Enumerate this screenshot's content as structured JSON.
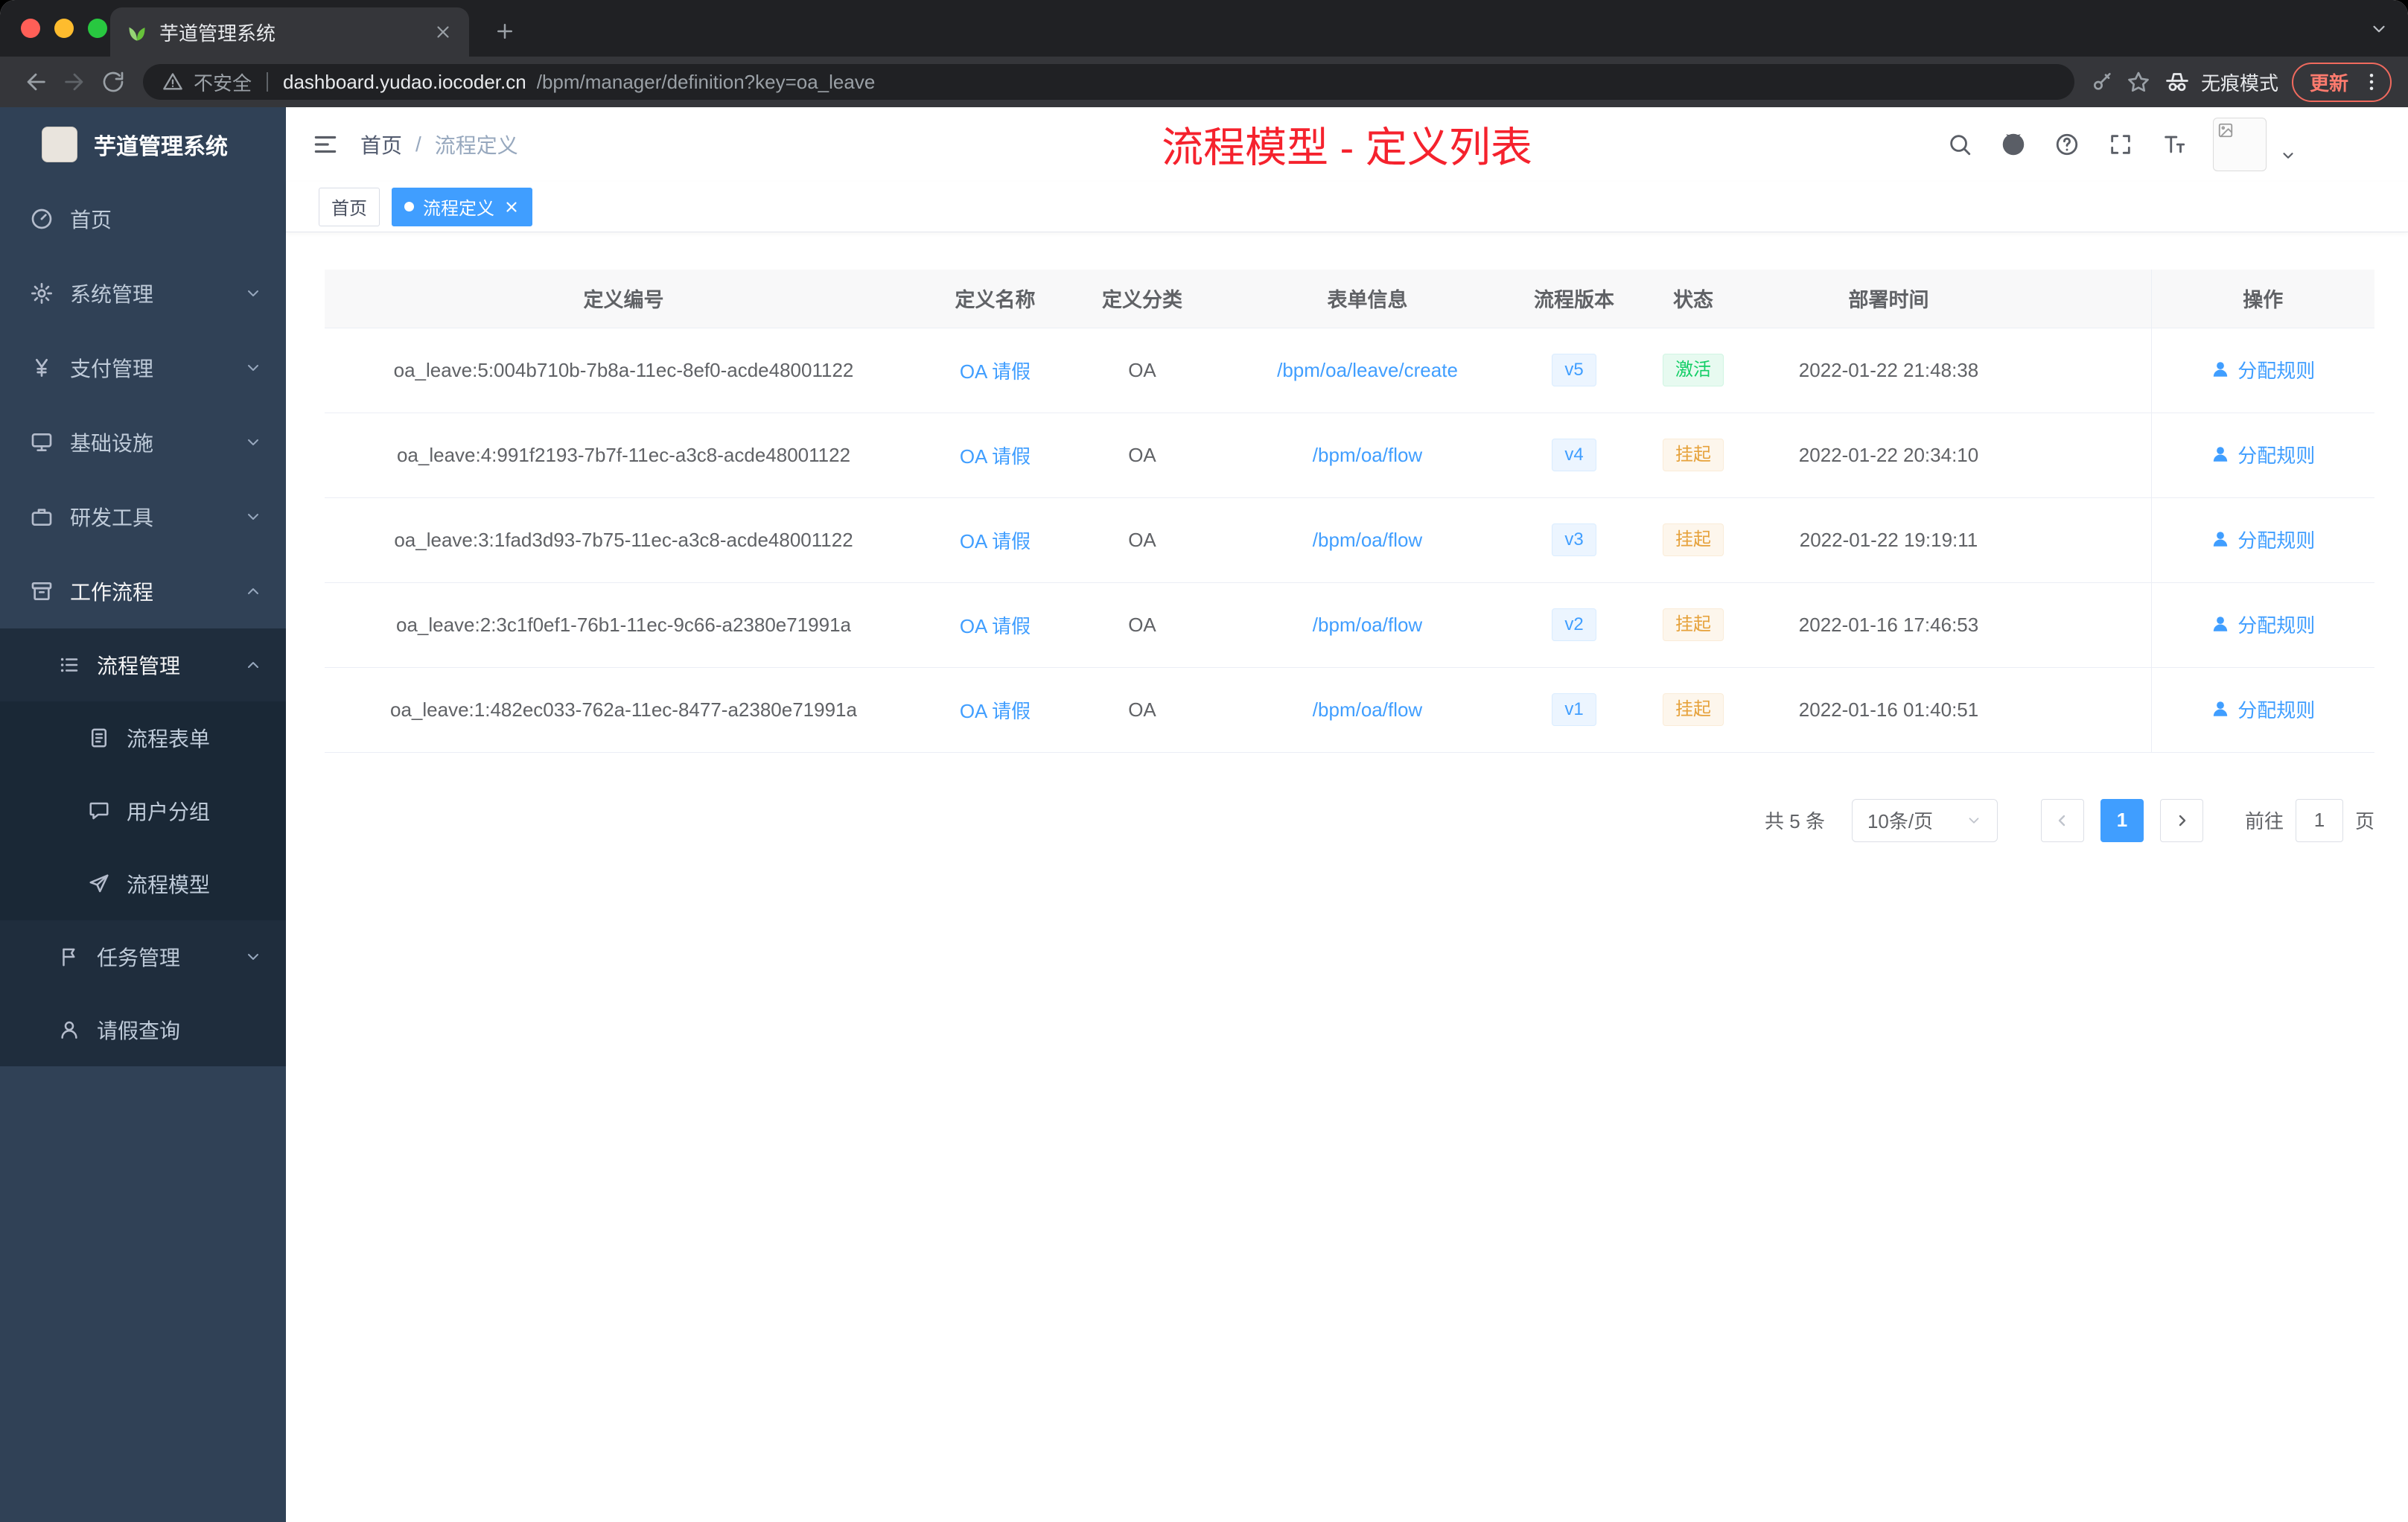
{
  "browser": {
    "tab_title": "芋道管理系统",
    "security_label": "不安全",
    "url_domain": "dashboard.yudao.iocoder.cn",
    "url_path": "/bpm/manager/definition?key=oa_leave",
    "incognito_label": "无痕模式",
    "update_label": "更新"
  },
  "sidebar": {
    "app_title": "芋道管理系统",
    "home": "首页",
    "system_mgmt": "系统管理",
    "payment_mgmt": "支付管理",
    "infrastructure": "基础设施",
    "dev_tools": "研发工具",
    "workflow": "工作流程",
    "process_mgmt": "流程管理",
    "process_form": "流程表单",
    "user_group": "用户分组",
    "process_model": "流程模型",
    "task_mgmt": "任务管理",
    "leave_query": "请假查询"
  },
  "header": {
    "breadcrumb_home": "首页",
    "breadcrumb_sep": "/",
    "breadcrumb_current": "流程定义",
    "annotation": "流程模型 - 定义列表"
  },
  "tags": {
    "home": "首页",
    "active": "流程定义"
  },
  "table": {
    "columns": [
      "定义编号",
      "定义名称",
      "定义分类",
      "表单信息",
      "流程版本",
      "状态",
      "部署时间",
      "操作"
    ],
    "rows": [
      {
        "id": "oa_leave:5:004b710b-7b8a-11ec-8ef0-acde48001122",
        "name": "OA 请假",
        "category": "OA",
        "form": "/bpm/oa/leave/create",
        "version": "v5",
        "status": "激活",
        "time": "2022-01-22 21:48:38",
        "action": "分配规则"
      },
      {
        "id": "oa_leave:4:991f2193-7b7f-11ec-a3c8-acde48001122",
        "name": "OA 请假",
        "category": "OA",
        "form": "/bpm/oa/flow",
        "version": "v4",
        "status": "挂起",
        "time": "2022-01-22 20:34:10",
        "action": "分配规则"
      },
      {
        "id": "oa_leave:3:1fad3d93-7b75-11ec-a3c8-acde48001122",
        "name": "OA 请假",
        "category": "OA",
        "form": "/bpm/oa/flow",
        "version": "v3",
        "status": "挂起",
        "time": "2022-01-22 19:19:11",
        "action": "分配规则"
      },
      {
        "id": "oa_leave:2:3c1f0ef1-76b1-11ec-9c66-a2380e71991a",
        "name": "OA 请假",
        "category": "OA",
        "form": "/bpm/oa/flow",
        "version": "v2",
        "status": "挂起",
        "time": "2022-01-16 17:46:53",
        "action": "分配规则"
      },
      {
        "id": "oa_leave:1:482ec033-762a-11ec-8477-a2380e71991a",
        "name": "OA 请假",
        "category": "OA",
        "form": "/bpm/oa/flow",
        "version": "v1",
        "status": "挂起",
        "time": "2022-01-16 01:40:51",
        "action": "分配规则"
      }
    ]
  },
  "pagination": {
    "total": "共 5 条",
    "page_size": "10条/页",
    "current_page": "1",
    "goto_label": "前往",
    "goto_value": "1",
    "page_unit": "页"
  },
  "colors": {
    "accent": "#409eff",
    "annotation_red": "#f5222d",
    "status_active": "#13ce66",
    "status_suspended": "#e6a23c",
    "sidebar_bg": "#304156",
    "submenu_bg": "#1f2d3d"
  }
}
